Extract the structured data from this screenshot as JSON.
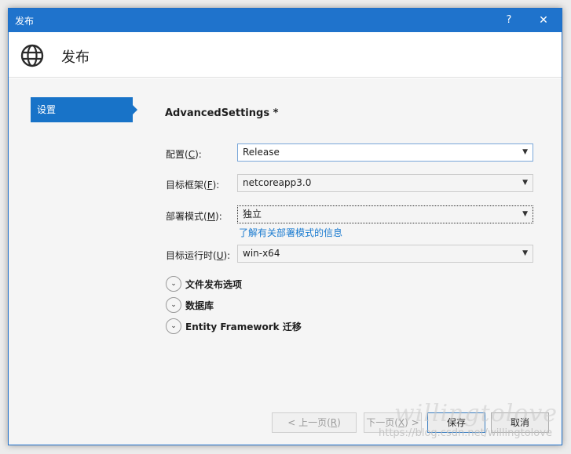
{
  "window": {
    "title": "发布",
    "help_label": "?",
    "close_label": "✕",
    "heading": "发布"
  },
  "sidebar": {
    "items": [
      {
        "label": "设置",
        "selected": true
      }
    ]
  },
  "settings": {
    "section_title": "AdvancedSettings *",
    "fields": [
      {
        "label_prefix": "配置(",
        "mnemonic": "C",
        "label_suffix": "):",
        "value": "Release"
      },
      {
        "label_prefix": "目标框架(",
        "mnemonic": "F",
        "label_suffix": "):",
        "value": "netcoreapp3.0"
      },
      {
        "label_prefix": "部署模式(",
        "mnemonic": "M",
        "label_suffix": "):",
        "value": "独立"
      },
      {
        "label_prefix": "目标运行时(",
        "mnemonic": "U",
        "label_suffix": "):",
        "value": "win-x64"
      }
    ],
    "help_link": "了解有关部署模式的信息",
    "expanders": [
      {
        "label": "文件发布选项"
      },
      {
        "label": "数据库"
      },
      {
        "label": "Entity Framework 迁移"
      }
    ]
  },
  "footer": {
    "prev_prefix": "< 上一页(",
    "prev_mnemonic": "R",
    "prev_suffix": ")",
    "next_prefix": "下一页(",
    "next_mnemonic": "X",
    "next_suffix": ") >",
    "save_label": "保存",
    "cancel_label": "取消"
  },
  "watermark": {
    "script_text": "willingtolove",
    "url_text": "https://blog.csdn.net/willingtolove"
  },
  "colors": {
    "titlebar": "#1f73cc",
    "accent": "#1873c8",
    "link": "#1a7bd0"
  },
  "icons": {
    "header": "globe-icon",
    "dropdown": "chevron-down-icon",
    "expander": "expand-chevron-icon"
  }
}
